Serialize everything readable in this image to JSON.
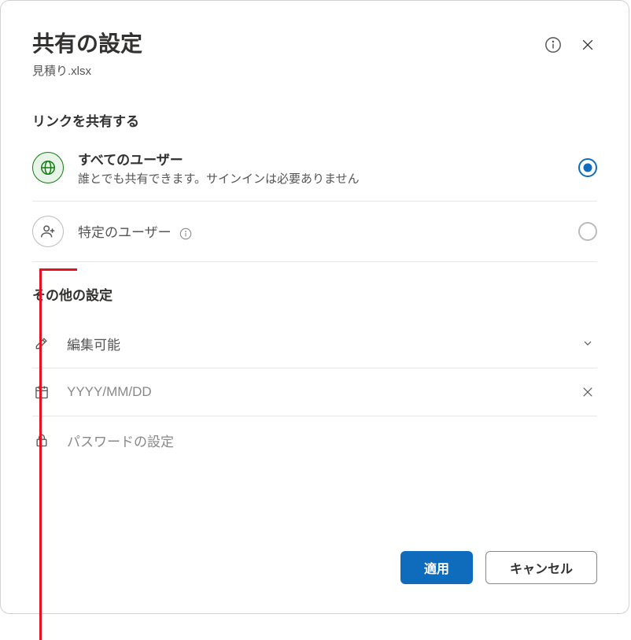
{
  "header": {
    "title": "共有の設定",
    "subtitle": "見積り.xlsx"
  },
  "shareLink": {
    "heading": "リンクを共有する",
    "options": {
      "anyone": {
        "label": "すべてのユーザー",
        "sub": "誰とでも共有できます。サインインは必要ありません"
      },
      "specific": {
        "label": "特定のユーザー"
      }
    }
  },
  "other": {
    "heading": "その他の設定",
    "permission": "編集可能",
    "expiryPlaceholder": "YYYY/MM/DD",
    "passwordPlaceholder": "パスワードの設定"
  },
  "footer": {
    "apply": "適用",
    "cancel": "キャンセル"
  }
}
